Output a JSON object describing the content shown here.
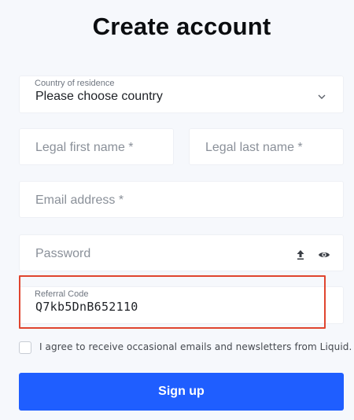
{
  "page": {
    "title": "Create account"
  },
  "form": {
    "country": {
      "label": "Country of residence",
      "value": "Please choose country",
      "icon": "chevron-down-icon"
    },
    "first_name": {
      "placeholder": "Legal first name *"
    },
    "last_name": {
      "placeholder": "Legal last name *"
    },
    "email": {
      "placeholder": "Email address *"
    },
    "password": {
      "placeholder": "Password",
      "icons": [
        "upload-icon",
        "eye-icon"
      ]
    },
    "referral": {
      "label": "Referral Code",
      "value": "Q7kb5DnB652110"
    },
    "agree_text": "I agree to receive occasional emails and newsletters from Liquid.",
    "agree_checked": false,
    "submit_label": "Sign up"
  },
  "colors": {
    "background": "#f6f8fc",
    "button": "#1f5eff",
    "highlight": "#e0452f"
  }
}
